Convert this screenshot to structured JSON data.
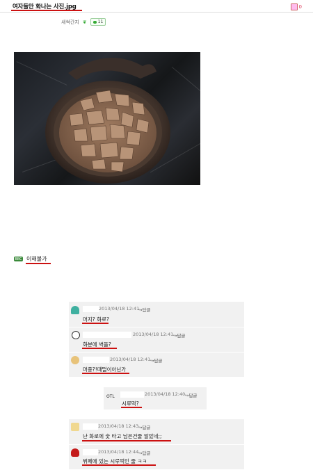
{
  "post": {
    "title": "여자들만 화나는 사진.jpg",
    "like_count": "0",
    "author": "새싹간지",
    "comment_count": "11"
  },
  "verdict": {
    "badge": "BBC",
    "text": "이해불가"
  },
  "comments": [
    {
      "date": "2013/04/18 12:41",
      "reply": "↪답글",
      "text": "머지? 화로?"
    },
    {
      "date": "2013/04/18 12:41",
      "reply": "↪답글",
      "text": "화분에 벽돌?"
    },
    {
      "date": "2013/04/18 12:41",
      "reply": "↪답글",
      "text": "머중?!때떨이아닌가"
    },
    {
      "date": "2013/04/18 12:40",
      "reply": "↪답글",
      "text": "시루떡?",
      "avatar_text": "OTL"
    },
    {
      "date": "2013/04/18 12:43",
      "reply": "↪답글",
      "text": "난 화로에 숯 타고 남은건줄 알았네;;"
    },
    {
      "date": "2013/04/18 12:44",
      "reply": "↪답글",
      "text": "뷔페에 있는 시루떡인 줄 ㅋㅋ"
    }
  ],
  "colors": {
    "accent_underline": "#cc1111",
    "comment_bg": "#f1f1f1"
  },
  "icons": [
    "thumbs-up-icon",
    "leaf-icon",
    "speech-bubble-icon",
    "reply-arrow-icon"
  ]
}
